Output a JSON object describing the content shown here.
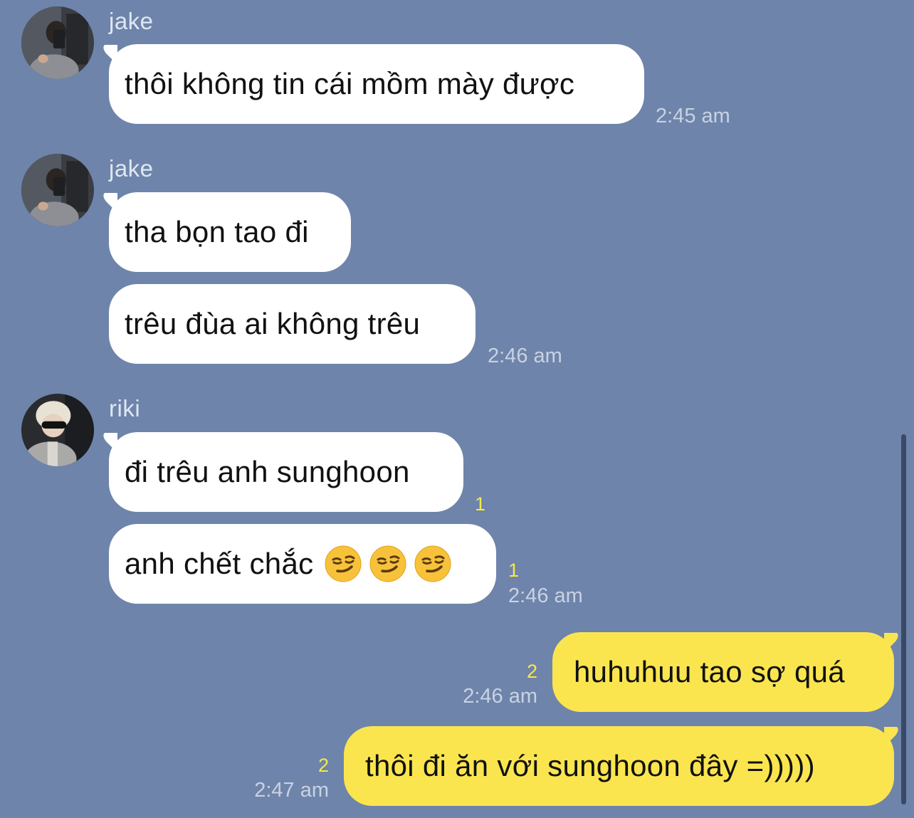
{
  "colors": {
    "background": "#6e84aa",
    "incoming_bubble": "#ffffff",
    "outgoing_bubble": "#fae54f",
    "unread_count": "#f5e94a",
    "timestamp": "#c8d2e3"
  },
  "messages": [
    {
      "group": "jake-1",
      "sender": "jake",
      "bubbles": [
        "thôi không tin cái mồm mày được"
      ],
      "time": "2:45 am"
    },
    {
      "group": "jake-2",
      "sender": "jake",
      "bubbles": [
        "tha bọn tao đi",
        "trêu đùa ai không trêu"
      ],
      "time": "2:46 am"
    },
    {
      "group": "riki-1",
      "sender": "riki",
      "bubbles": [
        "đi trêu anh sunghoon",
        "anh chết chắc"
      ],
      "unread": [
        "1",
        "1"
      ],
      "emoji": "smirking-face-icon",
      "time": "2:46 am"
    }
  ],
  "outgoing": [
    {
      "text": "huhuhuu tao sợ quá",
      "unread": "2",
      "time": "2:46 am"
    },
    {
      "text": "thôi đi ăn với sunghoon đây =)))))",
      "unread": "2",
      "time": "2:47 am"
    }
  ]
}
